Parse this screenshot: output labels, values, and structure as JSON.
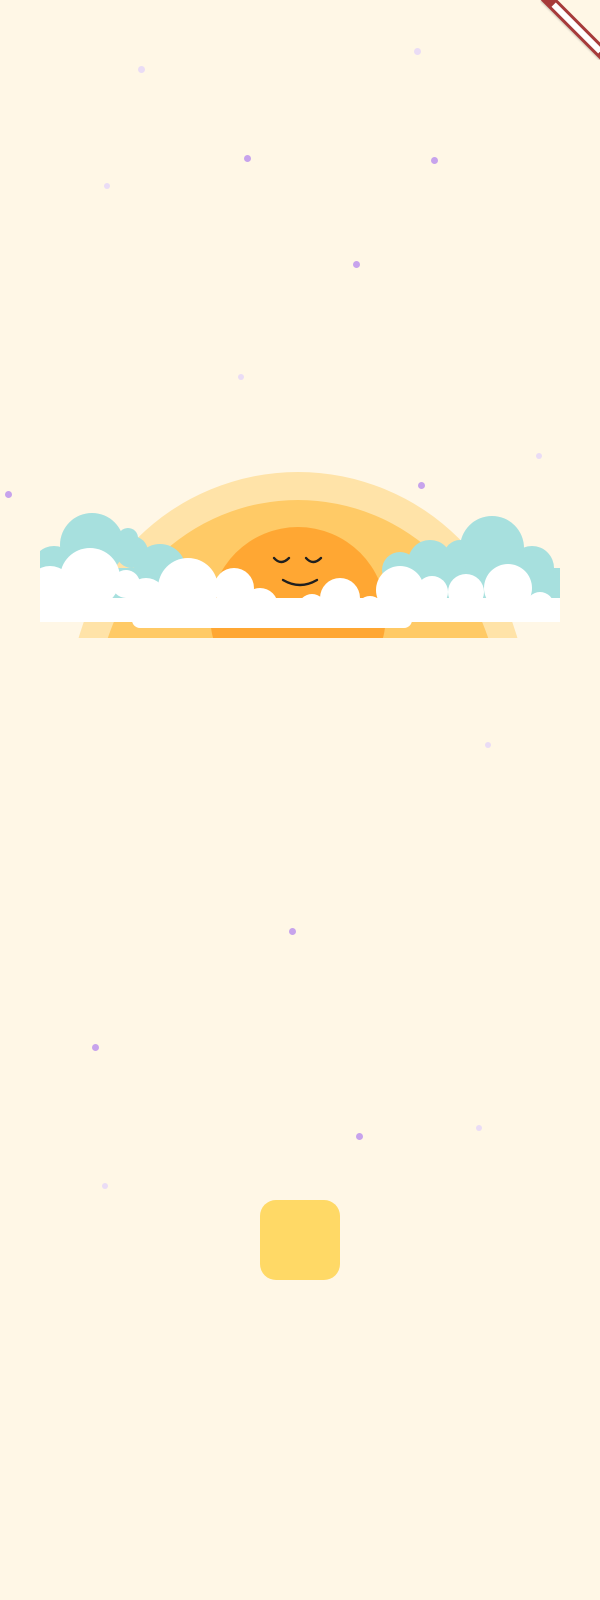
{
  "onboarding": {
    "headline": "",
    "body": "",
    "cta_label": ""
  },
  "illustration": {
    "icon": "sleeping-sun-icon",
    "colors": {
      "sun": "#ffa733",
      "glow_inner": "#ffca66",
      "glow_outer": "#ffe3a8",
      "cloud_back": "#a7e0de",
      "cloud_front": "#ffffff",
      "face": "#1f1f1f"
    }
  },
  "theme": {
    "background": "#fff7e6",
    "text": "#333333",
    "button": "#ffd966",
    "debug_banner": "#a63a3a"
  },
  "decor_dot_colors": [
    "#c7a3ec",
    "#eadcf5"
  ]
}
